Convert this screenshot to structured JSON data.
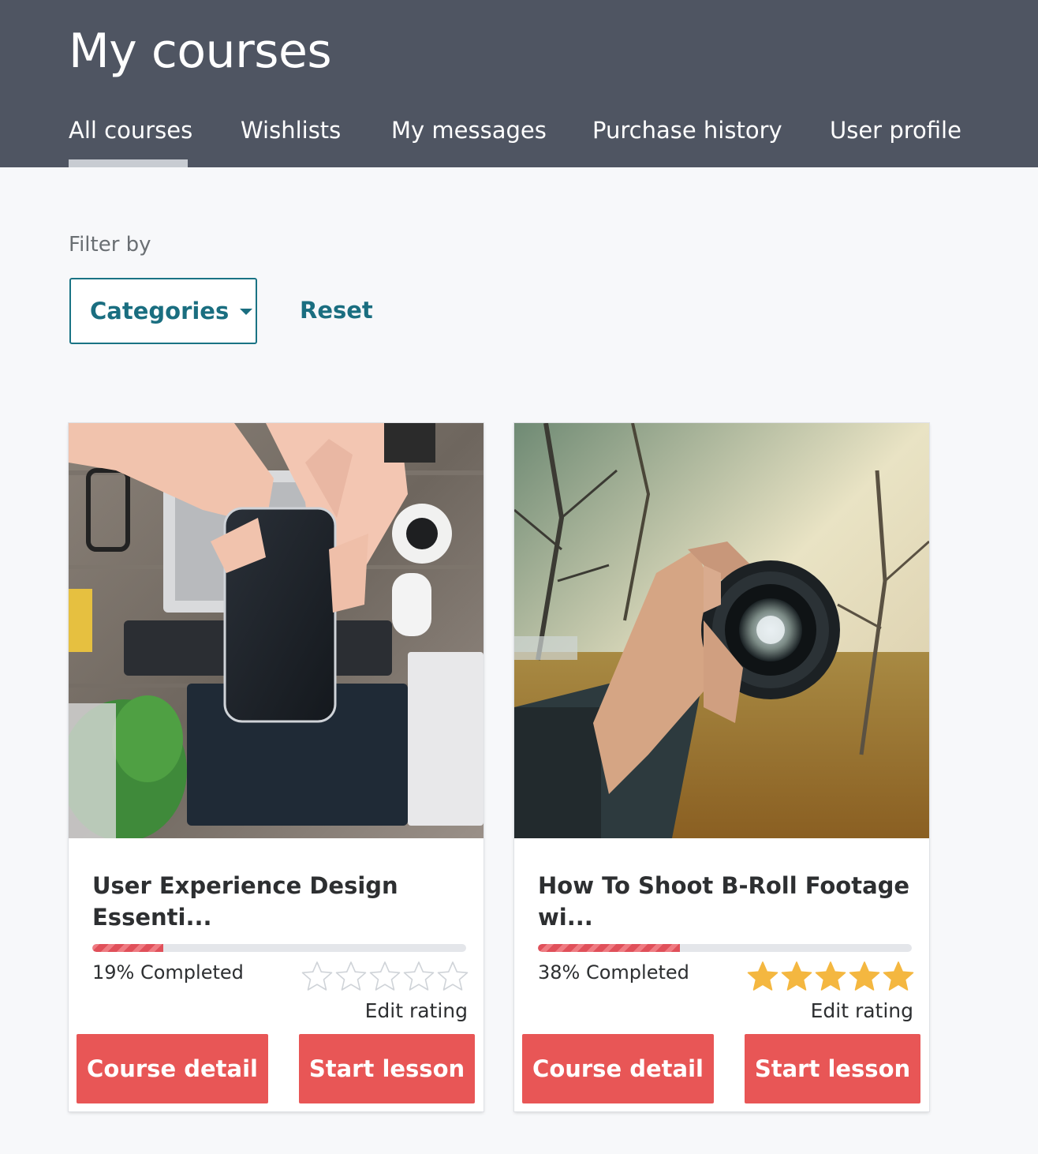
{
  "header": {
    "title": "My courses",
    "tabs": [
      {
        "label": "All courses",
        "active": true
      },
      {
        "label": "Wishlists",
        "active": false
      },
      {
        "label": "My messages",
        "active": false
      },
      {
        "label": "Purchase history",
        "active": false
      },
      {
        "label": "User profile",
        "active": false
      }
    ]
  },
  "filter": {
    "label": "Filter by",
    "categories_label": "Categories",
    "reset_label": "Reset"
  },
  "courses": [
    {
      "title": "User Experience Design Essenti...",
      "progress_percent": 19,
      "progress_text": "19% Completed",
      "rating_stars_filled": 0,
      "rating_stars_total": 5,
      "edit_rating_label": "Edit rating",
      "course_detail_label": "Course detail",
      "start_lesson_label": "Start lesson",
      "image_icon": "smartphone-workspace-photo"
    },
    {
      "title": "How To Shoot B-Roll Footage wi...",
      "progress_percent": 38,
      "progress_text": "38% Completed",
      "rating_stars_filled": 5,
      "rating_stars_total": 5,
      "edit_rating_label": "Edit rating",
      "course_detail_label": "Course detail",
      "start_lesson_label": "Start lesson",
      "image_icon": "camera-lens-photo"
    }
  ],
  "colors": {
    "header_bg": "#4f5562",
    "accent_teal": "#1a6e80",
    "button_red": "#e85656",
    "star_gold": "#f4b740"
  }
}
